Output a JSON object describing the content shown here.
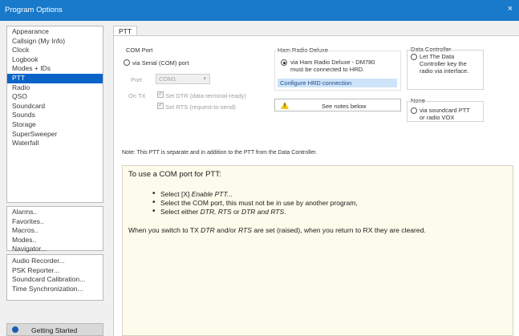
{
  "window": {
    "title": "Program Options",
    "close_glyph": "×"
  },
  "sidebar": {
    "group1": [
      "Appearance",
      "Callsign (My Info)",
      "Clock",
      "Logbook",
      "Modes + IDs",
      "PTT",
      "Radio",
      "QSO",
      "Soundcard",
      "Sounds",
      "Storage",
      "SuperSweeper",
      "Waterfall"
    ],
    "selected": "PTT",
    "group2": [
      "Alarms..",
      "Favorites..",
      "Macros..",
      "Modes..",
      "Navigator..."
    ],
    "group3": [
      "Audio Recorder...",
      "PSK Reporter...",
      "Soundcard Calibration...",
      "Time Synchronization..."
    ],
    "getting_started": "Getting Started"
  },
  "tab": {
    "label": "PTT"
  },
  "com_port": {
    "title": "COM Port",
    "radio_label": "via Serial (COM) port",
    "port_label": "Port",
    "port_value": "COM1",
    "on_tx_label": "On TX",
    "dtr_label": "Set DTR (data-terminal-ready)",
    "rts_label": "Set RTS (request-to-send)"
  },
  "hrd": {
    "title": "Ham Radio Deluxe",
    "radio_line1": "via Ham Radio Deluxe - DM780",
    "radio_line2": "must be connected to HRD.",
    "configure_button": "Configure HRD connection",
    "notes_button": "See notes below"
  },
  "data_controller": {
    "title": "Data Controller",
    "line1": "Let The Data",
    "line2": "Controller key the",
    "line3": "radio via interface."
  },
  "none_group": {
    "title": "None",
    "line1": "via soundcard PTT",
    "line2": "or radio VOX"
  },
  "note": "Note: This PTT is separate and in addition to the PTT from the Data Controller.",
  "info": {
    "heading": "To use a COM port for PTT:",
    "b1_prefix": "Select [X] ",
    "b1_em": "Enable PTT...",
    "b2": "Select the COM port, this must not be in use by another program,",
    "b3_prefix": "Select either ",
    "b3_em1": "DTR, RTS",
    "b3_mid": " or ",
    "b3_em2": "DTR and RTS",
    "b3_suffix": ".",
    "footer_a": "When you switch to TX ",
    "footer_em1": "DTR",
    "footer_b": " and/or ",
    "footer_em2": "RTS",
    "footer_c": " are set (raised), when you return to RX they are cleared."
  },
  "colors": {
    "titlebar": "#1979ca",
    "selection": "#0a64c8",
    "info_bg": "#fdfbeb",
    "hrd_button": "#cde3fa",
    "warning": "#f1c40f"
  }
}
